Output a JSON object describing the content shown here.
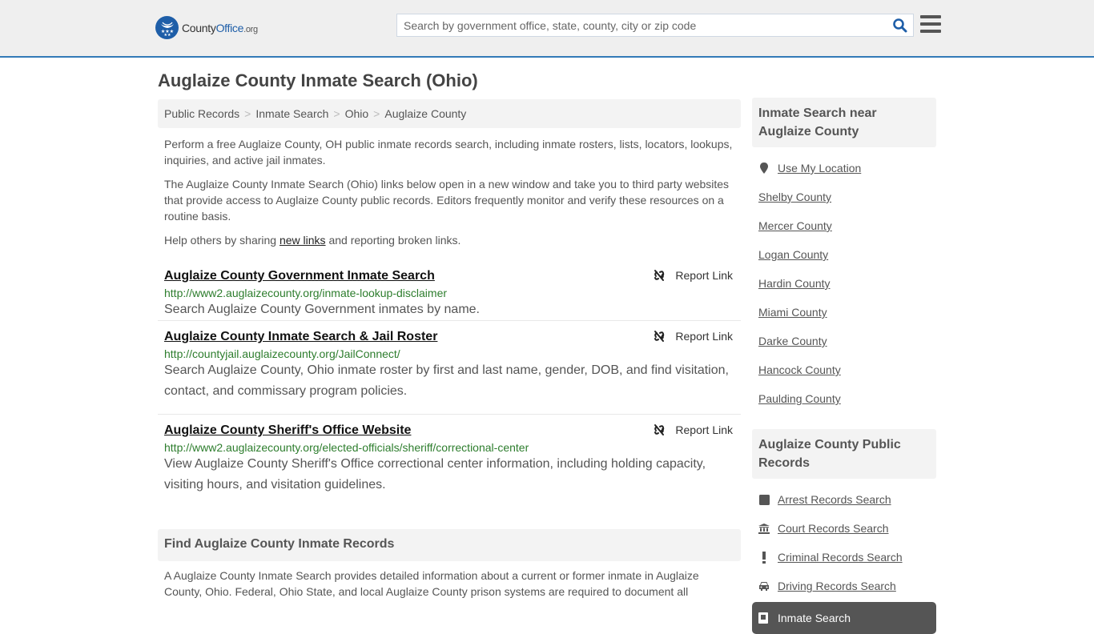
{
  "header": {
    "logo": {
      "name_part1": "County",
      "name_part2": "Office",
      "name_part3": ".org"
    },
    "search": {
      "placeholder": "Search by government office, state, county, city or zip code",
      "value": ""
    }
  },
  "page": {
    "title": "Auglaize County Inmate Search (Ohio)",
    "breadcrumb": [
      "Public Records",
      "Inmate Search",
      "Ohio",
      "Auglaize County"
    ],
    "breadcrumb_sep": ">"
  },
  "intro": {
    "p1": "Perform a free Auglaize County, OH public inmate records search, including inmate rosters, lists, locators, lookups, inquiries, and active jail inmates.",
    "p2": "The Auglaize County Inmate Search (Ohio) links below open in a new window and take you to third party websites that provide access to Auglaize County public records. Editors frequently monitor and verify these resources on a routine basis.",
    "p3_before": "Help others by sharing ",
    "p3_link": "new links",
    "p3_after": " and reporting broken links."
  },
  "results": [
    {
      "title": "Auglaize County Government Inmate Search",
      "url": "http://www2.auglaizecounty.org/inmate-lookup-disclaimer",
      "description": "Search Auglaize County Government inmates by name.",
      "report_label": "Report Link"
    },
    {
      "title": "Auglaize County Inmate Search & Jail Roster",
      "url": "http://countyjail.auglaizecounty.org/JailConnect/",
      "description": "Search Auglaize County, Ohio inmate roster by first and last name, gender, DOB, and find visitation, contact, and commissary program policies.",
      "report_label": "Report Link"
    },
    {
      "title": "Auglaize County Sheriff's Office Website",
      "url": "http://www2.auglaizecounty.org/elected-officials/sheriff/correctional-center",
      "description": "View Auglaize County Sheriff's Office correctional center information, including holding capacity, visiting hours, and visitation guidelines.",
      "report_label": "Report Link"
    }
  ],
  "find": {
    "heading": "Find Auglaize County Inmate Records",
    "text": "A Auglaize County Inmate Search provides detailed information about a current or former inmate in Auglaize County, Ohio. Federal, Ohio State, and local Auglaize County prison systems are required to document all"
  },
  "sidebar": {
    "nearby_heading": "Inmate Search near Auglaize County",
    "use_location": "Use My Location",
    "nearby": [
      "Shelby County",
      "Mercer County",
      "Logan County",
      "Hardin County",
      "Miami County",
      "Darke County",
      "Hancock County",
      "Paulding County"
    ],
    "records_heading": "Auglaize County Public Records",
    "records": [
      {
        "label": "Arrest Records Search",
        "icon": "square-icon"
      },
      {
        "label": "Court Records Search",
        "icon": "courthouse-icon"
      },
      {
        "label": "Criminal Records Search",
        "icon": "exclamation-icon"
      },
      {
        "label": "Driving Records Search",
        "icon": "car-icon"
      }
    ],
    "active_item": "Inmate Search"
  },
  "colors": {
    "brand_blue": "#1e5ea8",
    "header_border": "#337ab7",
    "url_green": "#2d7d2d",
    "active_bg": "#555555"
  }
}
